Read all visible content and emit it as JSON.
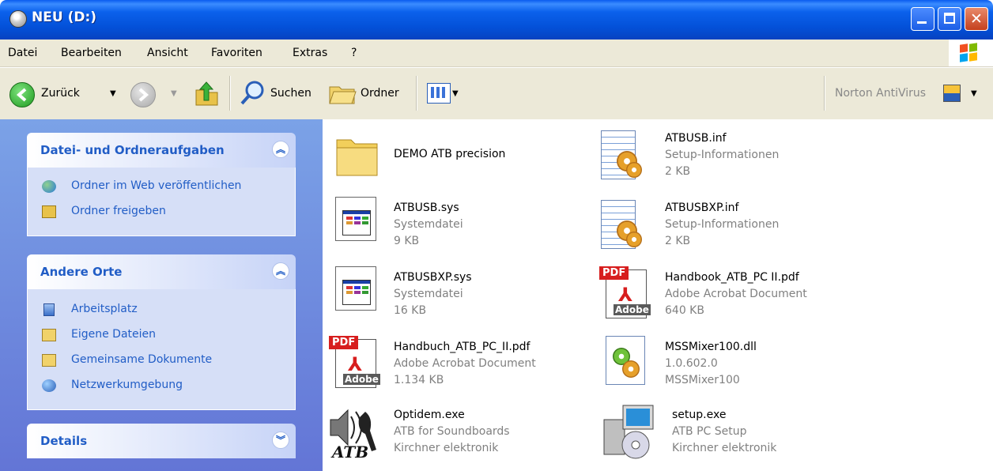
{
  "window": {
    "title": "NEU (D:)"
  },
  "menu": [
    "Datei",
    "Bearbeiten",
    "Ansicht",
    "Favoriten",
    "Extras",
    "?"
  ],
  "toolbar": {
    "back_label": "Zurück",
    "search_label": "Suchen",
    "folders_label": "Ordner",
    "norton_label": "Norton AntiVirus"
  },
  "tasks_panel": {
    "title": "Datei- und Ordneraufgaben",
    "links": [
      "Ordner im Web veröffentlichen",
      "Ordner freigeben"
    ]
  },
  "places_panel": {
    "title": "Andere Orte",
    "links": [
      "Arbeitsplatz",
      "Eigene Dateien",
      "Gemeinsame Dokumente",
      "Netzwerkumgebung"
    ]
  },
  "details_panel": {
    "title": "Details"
  },
  "files": [
    {
      "name": "DEMO ATB precision",
      "icon": "folder-icon"
    },
    {
      "name": "ATBUSB.inf",
      "type": "Setup-Informationen",
      "info": "2 KB",
      "icon": "setup-info-icon"
    },
    {
      "name": "ATBUSB.sys",
      "type": "Systemdatei",
      "info": "9 KB",
      "icon": "system-file-icon"
    },
    {
      "name": "ATBUSBXP.inf",
      "type": "Setup-Informationen",
      "info": "2 KB",
      "icon": "setup-info-icon"
    },
    {
      "name": "ATBUSBXP.sys",
      "type": "Systemdatei",
      "info": "16 KB",
      "icon": "system-file-icon"
    },
    {
      "name": "Handbook_ATB_PC II.pdf",
      "type": "Adobe Acrobat Document",
      "info": "640 KB",
      "icon": "pdf-icon"
    },
    {
      "name": "Handbuch_ATB_PC_II.pdf",
      "type": "Adobe Acrobat Document",
      "info": "1.134 KB",
      "icon": "pdf-icon"
    },
    {
      "name": "MSSMixer100.dll",
      "type": "1.0.602.0",
      "info": "MSSMixer100",
      "icon": "dll-icon"
    },
    {
      "name": "Optidem.exe",
      "type": "ATB for Soundboards",
      "info": "Kirchner elektronik",
      "icon": "speaker-app-icon"
    },
    {
      "name": "setup.exe",
      "type": "ATB PC Setup",
      "info": "Kirchner elektronik",
      "icon": "setup-exe-icon"
    }
  ],
  "colors": {
    "titlebar": "#0350d8",
    "taskpane": "#6375d6",
    "link": "#215dc6"
  }
}
